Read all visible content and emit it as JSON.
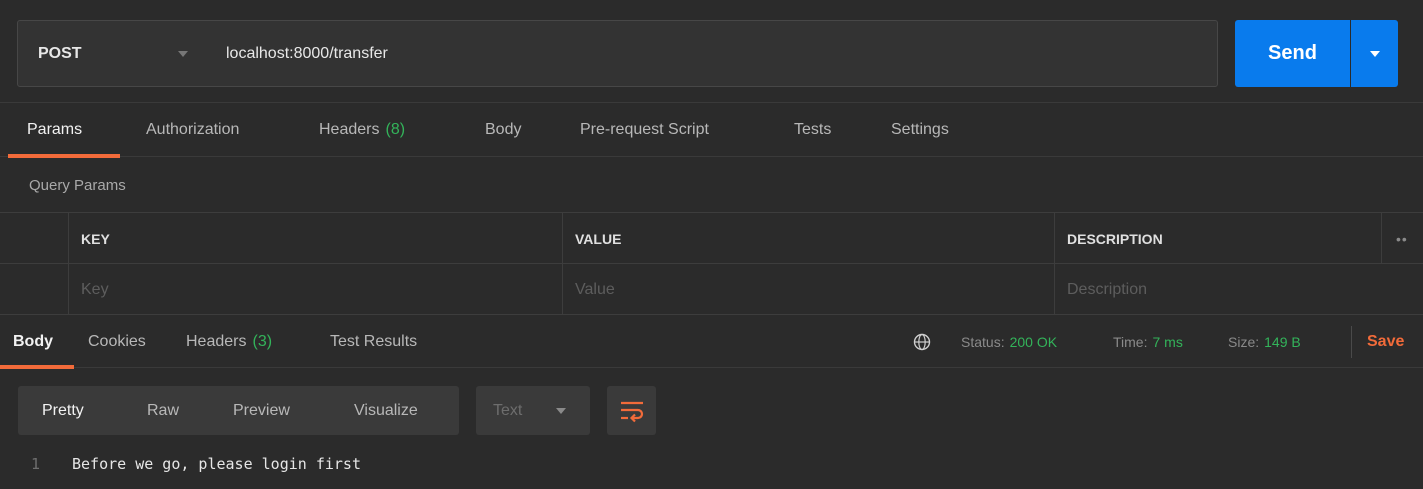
{
  "request": {
    "method": "POST",
    "url": "localhost:8000/transfer",
    "send_label": "Send"
  },
  "request_tabs": [
    {
      "label": "Params",
      "count": ""
    },
    {
      "label": "Authorization",
      "count": ""
    },
    {
      "label": "Headers",
      "count": "(8)"
    },
    {
      "label": "Body",
      "count": ""
    },
    {
      "label": "Pre-request Script",
      "count": ""
    },
    {
      "label": "Tests",
      "count": ""
    },
    {
      "label": "Settings",
      "count": ""
    }
  ],
  "query_params": {
    "title": "Query Params",
    "columns": [
      "KEY",
      "VALUE",
      "DESCRIPTION"
    ],
    "placeholders": [
      "Key",
      "Value",
      "Description"
    ],
    "more_icon": "more-dots-icon"
  },
  "response_tabs": [
    {
      "label": "Body",
      "count": ""
    },
    {
      "label": "Cookies",
      "count": ""
    },
    {
      "label": "Headers",
      "count": "(3)"
    },
    {
      "label": "Test Results",
      "count": ""
    }
  ],
  "response_status": {
    "status_label": "Status:",
    "status_value": "200 OK",
    "time_label": "Time:",
    "time_value": "7 ms",
    "size_label": "Size:",
    "size_value": "149 B",
    "save_label": "Save",
    "globe_icon": "globe-icon"
  },
  "body_toolbar": {
    "views": [
      "Pretty",
      "Raw",
      "Preview",
      "Visualize"
    ],
    "format": "Text",
    "wrap_icon": "wrap-lines-icon"
  },
  "response_body": {
    "lines": [
      {
        "number": "1",
        "text": "Before we go, please login first"
      }
    ]
  },
  "colors": {
    "accent": "#f26b3a",
    "send": "#097bed",
    "success": "#33b35a",
    "background": "#2b2b2b"
  }
}
